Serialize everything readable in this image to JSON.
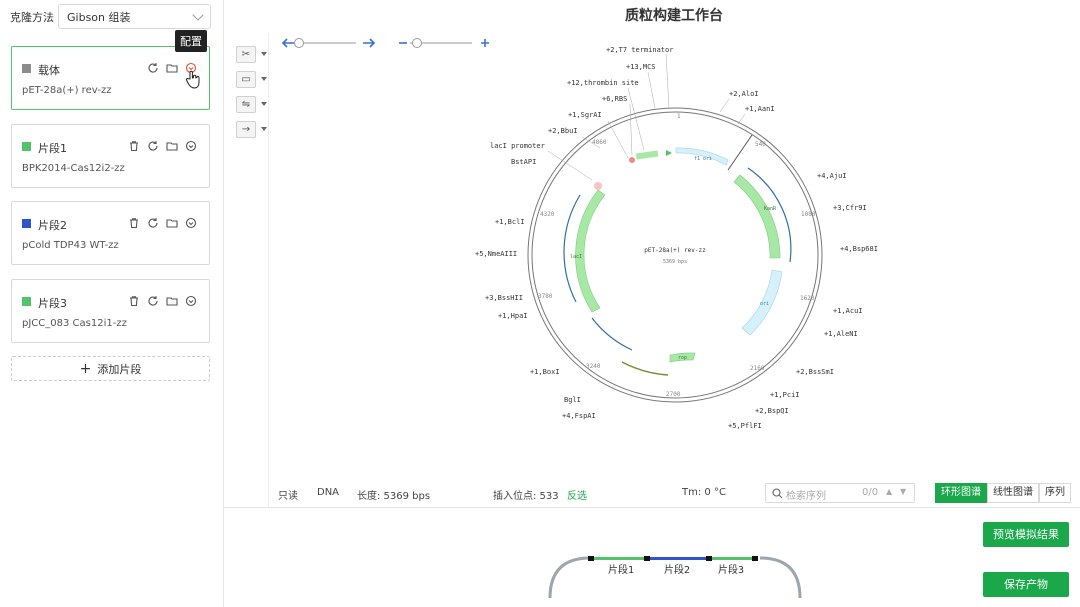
{
  "sidebar": {
    "method_label": "克隆方法",
    "method_value": "Gibson 组装",
    "tooltip": "配置",
    "add_label": "添加片段",
    "cards": [
      {
        "title": "载体",
        "sub": "pET-28a(+) rev-zz",
        "color": "#8c8c8c"
      },
      {
        "title": "片段1",
        "sub": "BPK2014-Cas12i2-zz",
        "color": "#52c26b"
      },
      {
        "title": "片段2",
        "sub": "pCold TDP43 WT-zz",
        "color": "#2f54c9"
      },
      {
        "title": "片段3",
        "sub": "pJCC_083 Cas12i1-zz",
        "color": "#52c26b"
      }
    ]
  },
  "main": {
    "title": "质粒构建工作台",
    "map": {
      "name": "pET-28a(+) rev-zz",
      "length_label": "5369 bps",
      "ticks": [
        "1",
        "540",
        "1080",
        "1620",
        "2160",
        "2700",
        "3240",
        "3780",
        "4320",
        "4860"
      ],
      "sites": [
        "+2,T7 terminator",
        "+13,MCS",
        "+12,thrombin site",
        "+6,RBS",
        "+1,SgrAI",
        "+2,BbuI",
        "lacI promoter",
        "BstAPI",
        "+1,BclI",
        "+5,NmeAIII",
        "+3,BssHII",
        "+1,HpaI",
        "+1,BoxI",
        "BglI",
        "+4,FspAI",
        "+2,AloI",
        "+1,AanI",
        "+4,AjuI",
        "+3,Cfr9I",
        "+4,Bsp68I",
        "+1,AcuI",
        "+1,AleNI",
        "+2,BssSmI",
        "+1,PciI",
        "+2,BspQI",
        "+5,PflFI"
      ],
      "features": [
        "f1 ori",
        "KanR",
        "ori",
        "rop",
        "lacI"
      ]
    }
  },
  "status": {
    "readonly": "只读",
    "type": "DNA",
    "length": "长度: 5369 bps",
    "insert": "插入位点: 533",
    "reverse": "反选",
    "tm": "Tm: 0 °C",
    "search_placeholder": "检索序列",
    "search_count": "0/0"
  },
  "views": {
    "circular": "环形图谱",
    "linear": "线性图谱",
    "sequence": "序列"
  },
  "buttons": {
    "preview": "预览模拟结果",
    "save": "保存产物"
  },
  "assembly": {
    "labels": [
      "片段1",
      "片段2",
      "片段3"
    ]
  },
  "colors": {
    "accent": "#1aa84b",
    "blue": "#2f54c9",
    "green": "#52c26b"
  }
}
